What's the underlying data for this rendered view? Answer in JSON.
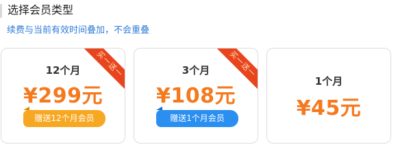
{
  "header": {
    "title": "选择会员类型",
    "subtitle": "续费与当前有效时间叠加，不会重叠"
  },
  "plans": [
    {
      "duration": "12个月",
      "price": "¥299元",
      "gift": "赠送12个月会员",
      "ribbon": "买一送一",
      "gift_color": "#f7a823"
    },
    {
      "duration": "3个月",
      "price": "¥108元",
      "gift": "赠送1个月会员",
      "ribbon": "买一送一",
      "gift_color": "#2a8ff0"
    },
    {
      "duration": "1个月",
      "price": "¥45元"
    }
  ],
  "colors": {
    "price": "#f47a1f",
    "subtitle": "#2f7bd8",
    "ribbon": "#e8441f"
  }
}
